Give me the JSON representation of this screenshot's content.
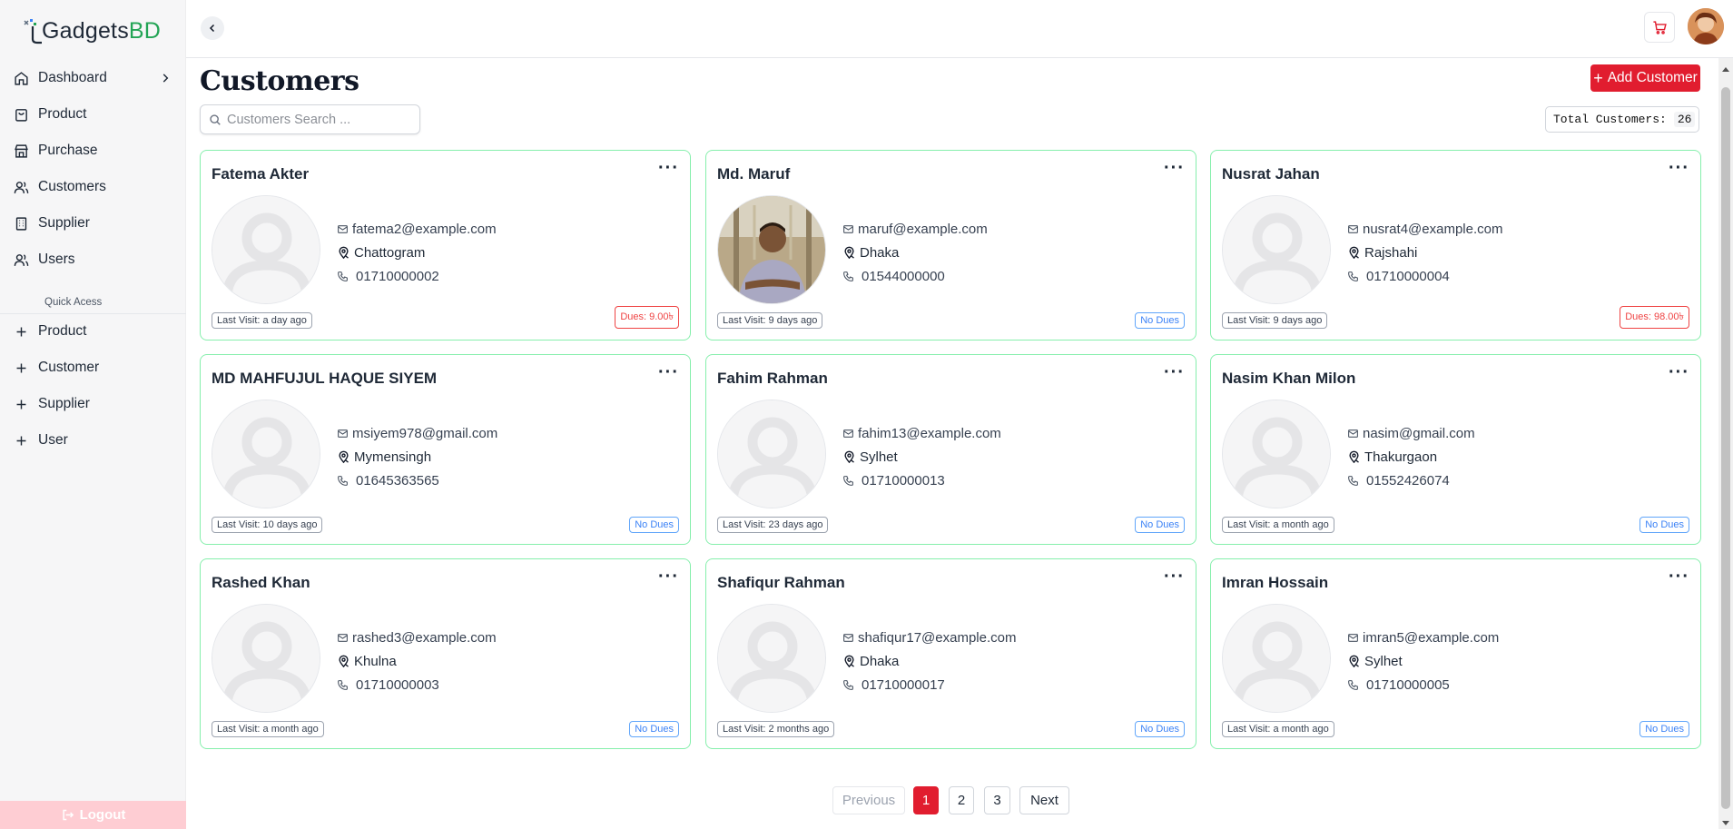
{
  "brand": {
    "name_main": "Gadgets",
    "name_accent": "BD"
  },
  "sidebar": {
    "items": [
      {
        "label": "Dashboard",
        "icon": "home-icon",
        "has_chevron": true
      },
      {
        "label": "Product",
        "icon": "bag-icon"
      },
      {
        "label": "Purchase",
        "icon": "store-icon"
      },
      {
        "label": "Customers",
        "icon": "users-icon"
      },
      {
        "label": "Supplier",
        "icon": "building-icon"
      },
      {
        "label": "Users",
        "icon": "users-icon"
      }
    ],
    "quick_access_label": "Quick Acess",
    "quick_items": [
      {
        "label": "Product",
        "icon": "plus-icon"
      },
      {
        "label": "Customer",
        "icon": "plus-icon"
      },
      {
        "label": "Supplier",
        "icon": "plus-icon"
      },
      {
        "label": "User",
        "icon": "plus-icon"
      }
    ],
    "logout_label": "Logout"
  },
  "page": {
    "title": "Customers",
    "add_label": "Add Customer",
    "search_placeholder": "Customers Search ...",
    "total_label": "Total Customers:",
    "total_count": "26"
  },
  "customers": [
    {
      "name": "Fatema Akter",
      "email": "fatema2@example.com",
      "city": "Chattogram",
      "phone": "01710000002",
      "last_visit": "Last Visit: a day ago",
      "dues": "Dues: 9.00৳",
      "has_dues": true,
      "photo": false
    },
    {
      "name": "Md. Maruf",
      "email": "maruf@example.com",
      "city": "Dhaka",
      "phone": "01544000000",
      "last_visit": "Last Visit: 9 days ago",
      "dues": "No Dues",
      "has_dues": false,
      "photo": true
    },
    {
      "name": "Nusrat Jahan",
      "email": "nusrat4@example.com",
      "city": "Rajshahi",
      "phone": "01710000004",
      "last_visit": "Last Visit: 9 days ago",
      "dues": "Dues: 98.00৳",
      "has_dues": true,
      "photo": false
    },
    {
      "name": "MD MAHFUJUL HAQUE SIYEM",
      "email": "msiyem978@gmail.com",
      "city": "Mymensingh",
      "phone": "01645363565",
      "last_visit": "Last Visit: 10 days ago",
      "dues": "No Dues",
      "has_dues": false,
      "photo": false
    },
    {
      "name": "Fahim Rahman",
      "email": "fahim13@example.com",
      "city": "Sylhet",
      "phone": "01710000013",
      "last_visit": "Last Visit: 23 days ago",
      "dues": "No Dues",
      "has_dues": false,
      "photo": false
    },
    {
      "name": "Nasim Khan Milon",
      "email": "nasim@gmail.com",
      "city": "Thakurgaon",
      "phone": "01552426074",
      "last_visit": "Last Visit: a month ago",
      "dues": "No Dues",
      "has_dues": false,
      "photo": false
    },
    {
      "name": "Rashed Khan",
      "email": "rashed3@example.com",
      "city": "Khulna",
      "phone": "01710000003",
      "last_visit": "Last Visit: a month ago",
      "dues": "No Dues",
      "has_dues": false,
      "photo": false
    },
    {
      "name": "Shafiqur Rahman",
      "email": "shafiqur17@example.com",
      "city": "Dhaka",
      "phone": "01710000017",
      "last_visit": "Last Visit: 2 months ago",
      "dues": "No Dues",
      "has_dues": false,
      "photo": false
    },
    {
      "name": "Imran Hossain",
      "email": "imran5@example.com",
      "city": "Sylhet",
      "phone": "01710000005",
      "last_visit": "Last Visit: a month ago",
      "dues": "No Dues",
      "has_dues": false,
      "photo": false
    }
  ],
  "pagination": {
    "previous": "Previous",
    "pages": [
      "1",
      "2",
      "3"
    ],
    "current": "1",
    "next": "Next"
  },
  "colors": {
    "accent": "#e11d2f",
    "brand_green": "#23a455",
    "card_border": "#86efac",
    "dues_red": "#ef4444",
    "no_dues_blue": "#3b82f6"
  }
}
